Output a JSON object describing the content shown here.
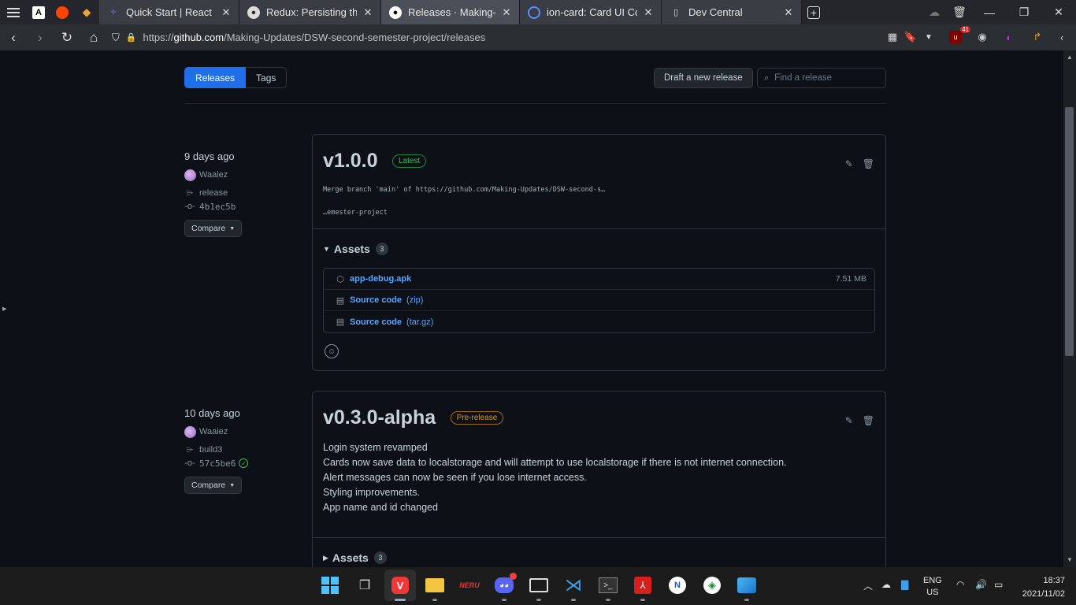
{
  "browser": {
    "tabs": [
      {
        "title": "Quick Start | React Red",
        "favicon": "redux-icon"
      },
      {
        "title": "Redux: Persisting the St",
        "favicon": "anon-icon"
      },
      {
        "title": "Releases · Making-Upd",
        "favicon": "github-icon"
      },
      {
        "title": "ion-card: Card UI Comp",
        "favicon": "ionic-icon"
      },
      {
        "title": "Dev Central",
        "favicon": "page-icon"
      }
    ],
    "url_prefix": "https://",
    "url_host": "github.com",
    "url_path": "/Making-Updates/DSW-second-semester-project/releases",
    "extension_badge": "41"
  },
  "subnav": {
    "releases": "Releases",
    "tags": "Tags"
  },
  "draft_button": "Draft a new release",
  "search_placeholder": "Find a release",
  "releases": [
    {
      "when": "9 days ago",
      "author": "Waaiez",
      "tag": "release",
      "commit": "4b1ec5b",
      "compare": "Compare",
      "version": "v1.0.0",
      "label": "Latest",
      "body_line1": "Merge branch 'main' of https://github.com/Making-Updates/DSW-second-s…",
      "body_line2": "…emester-project",
      "assets_title": "Assets",
      "assets_count": "3",
      "assets": [
        {
          "name": "app-debug.apk",
          "suffix": "",
          "size": "7.51 MB"
        },
        {
          "name": "Source code",
          "suffix": "(zip)",
          "size": ""
        },
        {
          "name": "Source code",
          "suffix": "(tar.gz)",
          "size": ""
        }
      ]
    },
    {
      "when": "10 days ago",
      "author": "Waaiez",
      "tag": "build3",
      "commit": "57c5be6",
      "compare": "Compare",
      "version": "v0.3.0-alpha",
      "label": "Pre-release",
      "notes": [
        "Login system revamped",
        "Cards now save data to localstorage and will attempt to use localstorage if there is not internet connection.",
        "Alert messages can now be seen if you lose internet access.",
        "Styling improvements.",
        "App name and id changed"
      ],
      "assets_title": "Assets",
      "assets_count": "3"
    }
  ],
  "taskbar": {
    "lang": "ENG",
    "region": "US",
    "time": "18:37",
    "date": "2021/11/02"
  },
  "colors": {
    "accent": "#1f6feb",
    "link": "#58a6ff",
    "latest": "#3fb950",
    "prerelease": "#d29922"
  }
}
